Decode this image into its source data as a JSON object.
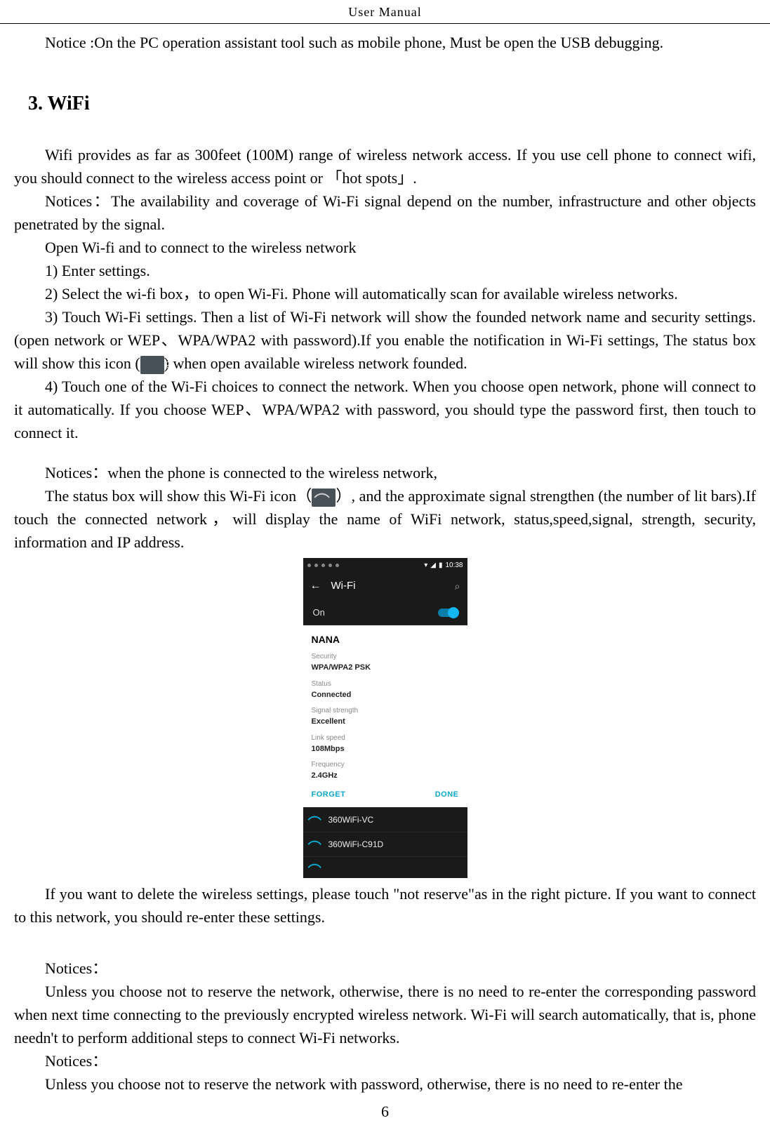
{
  "header": {
    "title": "User    Manual"
  },
  "body": {
    "notice_top": "Notice :On the PC operation assistant tool such as mobile phone, Must be open the USB debugging.",
    "section_title": "3. WiFi",
    "p1": "Wifi    provides as far as 300feet (100M) range of wireless network access. If you use cell phone to connect wifi, you should connect to the wireless access point or    「hot spots」.",
    "p2": "Notices：The availability and coverage of Wi-Fi signal depend on the number, infrastructure and other objects penetrated by the signal.",
    "p3": "Open Wi-fi and to connect to the wireless network",
    "p4": "1) Enter settings.",
    "p5": "2) Select the wi-fi box，to open Wi-Fi. Phone will automatically scan for available wireless networks.",
    "p6a": "3) Touch Wi-Fi settings. Then a list of Wi-Fi network will show the founded network name and security settings.  (open  network  or  WEP、WPA/WPA2  with  password).If  you  enable  the  notification  in    Wi-Fi settings, The status box will show this icon (",
    "p6b": ") when open available wireless network founded.",
    "p7": "4) Touch one of the Wi-Fi choices to connect the network. When you choose open network, phone will connect to it automatically. If you choose WEP、WPA/WPA2 with password, you should type the password first, then touch to connect it.",
    "p8": "Notices：when the phone is connected to the wireless network,",
    "p9a": "The status box will show this Wi-Fi icon（",
    "p9b": "）, and the approximate signal strengthen (the number of lit  bars).If  touch  the  connected  network，will  display  the  name  of  WiFi    network,  status,speed,signal, strength, security, information and IP address.",
    "p10": "If you want to delete the wireless settings, please touch \"not reserve\"as in the right picture. If you want to connect to this network, you should re-enter these settings.",
    "p11_label": "Notices：",
    "p11": "Unless you choose not to reserve the network, otherwise, there is no need to re-enter the corresponding password  when  next  time  connecting  to  the  previously  encrypted  wireless  network.  Wi-Fi  will  search automatically, that is, phone needn't to perform additional steps to connect Wi-Fi networks.",
    "p12_label": "Notices：",
    "p12": "Unless you choose not to reserve the network with password, otherwise, there is no need to re-enter the"
  },
  "phone": {
    "time": "10:38",
    "wifi_title": "Wi-Fi",
    "on_label": "On",
    "dialog": {
      "ssid": "NANA",
      "security_label": "Security",
      "security_value": "WPA/WPA2 PSK",
      "status_label": "Status",
      "status_value": "Connected",
      "signal_label": "Signal strength",
      "signal_value": "Excellent",
      "speed_label": "Link speed",
      "speed_value": "108Mbps",
      "freq_label": "Frequency",
      "freq_value": "2.4GHz",
      "forget": "FORGET",
      "done": "DONE"
    },
    "networks": [
      "360WiFi-VC",
      "360WiFi-C91D"
    ]
  },
  "page_number": "6"
}
